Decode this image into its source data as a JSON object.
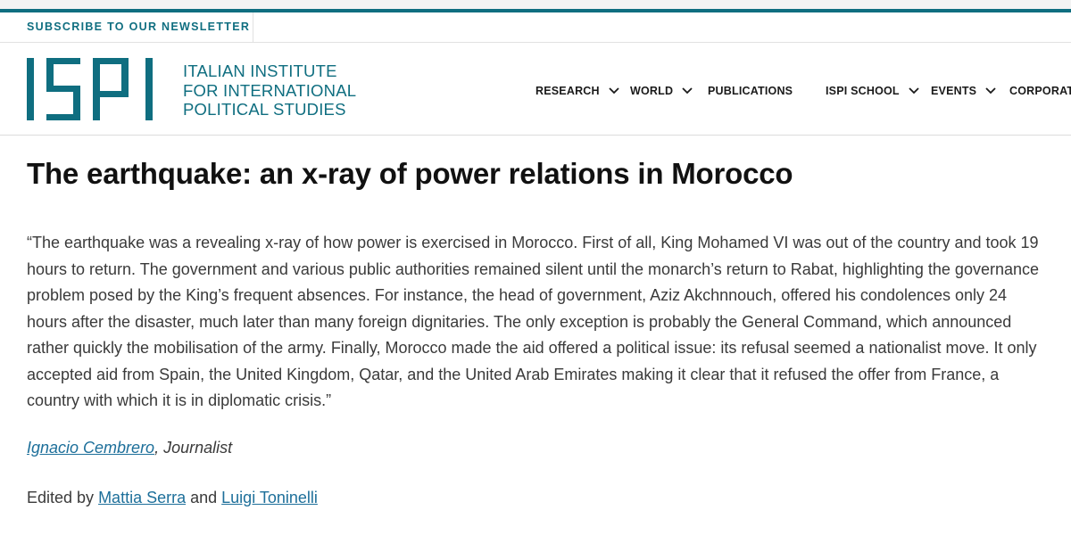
{
  "colors": {
    "accent": "#0f6e80",
    "link": "#1d6f9a",
    "text": "#3a3a3a",
    "title": "#111111"
  },
  "top": {
    "newsletter_label": "SUBSCRIBE TO OUR NEWSLETTER"
  },
  "header": {
    "logo_text": "ISPI",
    "institute_lines": [
      "ITALIAN INSTITUTE",
      "FOR INTERNATIONAL",
      "POLITICAL STUDIES"
    ],
    "nav": [
      {
        "label": "RESEARCH",
        "has_dropdown": true,
        "icon": "chevron-down-icon"
      },
      {
        "label": "WORLD",
        "has_dropdown": true,
        "icon": "chevron-down-icon"
      },
      {
        "label": "PUBLICATIONS",
        "has_dropdown": false
      },
      {
        "label": "ISPI SCHOOL",
        "has_dropdown": true,
        "icon": "chevron-down-icon"
      },
      {
        "label": "EVENTS",
        "has_dropdown": true,
        "icon": "chevron-down-icon"
      },
      {
        "label": "CORPORAT",
        "has_dropdown": false
      }
    ]
  },
  "article": {
    "title": "The earthquake: an x-ray of power relations in Morocco",
    "quote": "“The earthquake was a revealing x-ray of how power is exercised in Morocco. First of all, King Mohamed VI was out of the country and took 19 hours to return. The government and various public authorities remained silent until the monarch’s return to Rabat, highlighting the governance problem posed by the King’s frequent absences. For instance, the head of government, Aziz Akchnnouch, offered his condolences only 24 hours after the disaster, much later than many foreign dignitaries. The only exception is probably the General Command, which announced rather quickly the mobilisation of the army. Finally, Morocco made the aid offered a political issue: its refusal seemed a nationalist move. It only accepted aid from Spain, the United Kingdom, Qatar, and the United Arab Emirates making it clear that it refused the offer from France, a country with which it is in diplomatic crisis.”",
    "author_name": "Ignacio Cembrero",
    "author_role": ", Journalist",
    "edited_prefix": "Edited by ",
    "editor1": "Mattia Serra",
    "editor_join": " and ",
    "editor2": "Luigi Toninelli"
  }
}
